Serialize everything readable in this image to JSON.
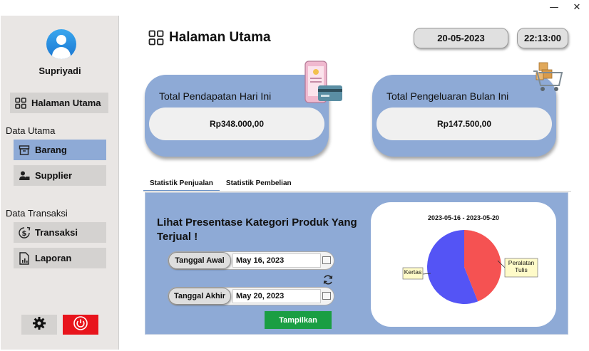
{
  "window": {
    "minimize_glyph": "—",
    "close_glyph": "✕"
  },
  "sidebar": {
    "username": "Supriyadi",
    "avatar_icon": "user-avatar-icon",
    "home_label": "Halaman Utama",
    "section_master": "Data Utama",
    "items_master": [
      {
        "label": "Barang",
        "icon": "box-icon"
      },
      {
        "label": "Supplier",
        "icon": "supplier-icon"
      }
    ],
    "section_transaction": "Data Transaksi",
    "items_transaction": [
      {
        "label": "Transaksi",
        "icon": "money-icon"
      },
      {
        "label": "Laporan",
        "icon": "report-icon"
      }
    ],
    "settings_icon": "gear-icon",
    "logout_icon": "power-icon"
  },
  "header": {
    "title": "Halaman Utama",
    "date": "20-05-2023",
    "time": "22:13:00"
  },
  "cards": [
    {
      "label": "Total Pendapatan Hari Ini",
      "value": "Rp348.000,00",
      "icon": "phone-payment-card-icon"
    },
    {
      "label": "Total Pengeluaran Bulan Ini",
      "value": "Rp147.500,00",
      "icon": "shopping-cart-icon"
    }
  ],
  "tabs": [
    {
      "label": "Statistik Penjualan",
      "active": true
    },
    {
      "label": "Statistik Pembelian",
      "active": false
    }
  ],
  "panel": {
    "title": "Lihat Presentase Kategori Produk Yang Terjual !",
    "start_label": "Tanggal Awal",
    "start_value": "May 16, 2023",
    "end_label": "Tanggal Akhir",
    "end_value": "May 20, 2023",
    "button_label": "Tampilkan"
  },
  "colors": {
    "accent": "#8eaad6",
    "button_green": "#1a9e43",
    "logout_red": "#e8141c",
    "slice_a": "#5454f5",
    "slice_b": "#f55252"
  },
  "chart_data": {
    "type": "pie",
    "title": "2023-05-16  -  2023-05-20",
    "slices": [
      {
        "name": "Kertas",
        "value": 56,
        "color": "#5454f5"
      },
      {
        "name": "Peralatan Tulis",
        "value": 44,
        "color": "#f55252"
      }
    ]
  }
}
